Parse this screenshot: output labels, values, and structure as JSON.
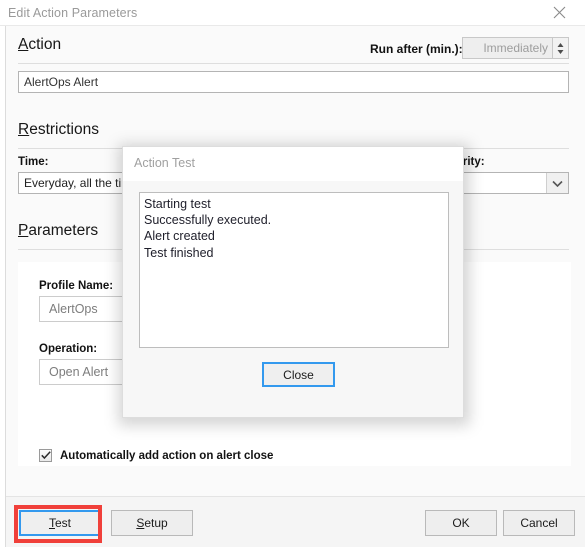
{
  "window": {
    "title": "Edit Action Parameters",
    "close_icon": "close-icon"
  },
  "action_section": {
    "heading_accel": "A",
    "heading_rest": "ction",
    "run_after_label": "Run after (min.):",
    "run_after_value": "Immediately",
    "action_name_value": "AlertOps Alert"
  },
  "restrictions_section": {
    "heading_accel": "R",
    "heading_rest": "estrictions",
    "time_label": "Time:",
    "time_value": "Everyday, all the time",
    "severity_label": "Severity:",
    "severity_value": ""
  },
  "parameters_section": {
    "heading_accel": "P",
    "heading_rest": "arameters",
    "profile_name_label": "Profile Name:",
    "profile_name_value": "AlertOps",
    "operation_label": "Operation:",
    "operation_value": "Open Alert",
    "auto_add_label": "Automatically add action on alert close",
    "auto_add_checked": true
  },
  "footer": {
    "test_accel": "T",
    "test_rest": "est",
    "setup_accel": "S",
    "setup_rest": "etup",
    "ok_label": "OK",
    "cancel_label": "Cancel"
  },
  "modal": {
    "title": "Action Test",
    "log_lines": [
      "Starting test",
      "Successfully executed.",
      "Alert created",
      "Test finished"
    ],
    "close_label": "Close"
  },
  "colors": {
    "highlight_red": "#f0403a",
    "focus_blue": "#3399ee",
    "panel_bg": "#fafafa",
    "footer_bg": "#f5f5f5"
  }
}
